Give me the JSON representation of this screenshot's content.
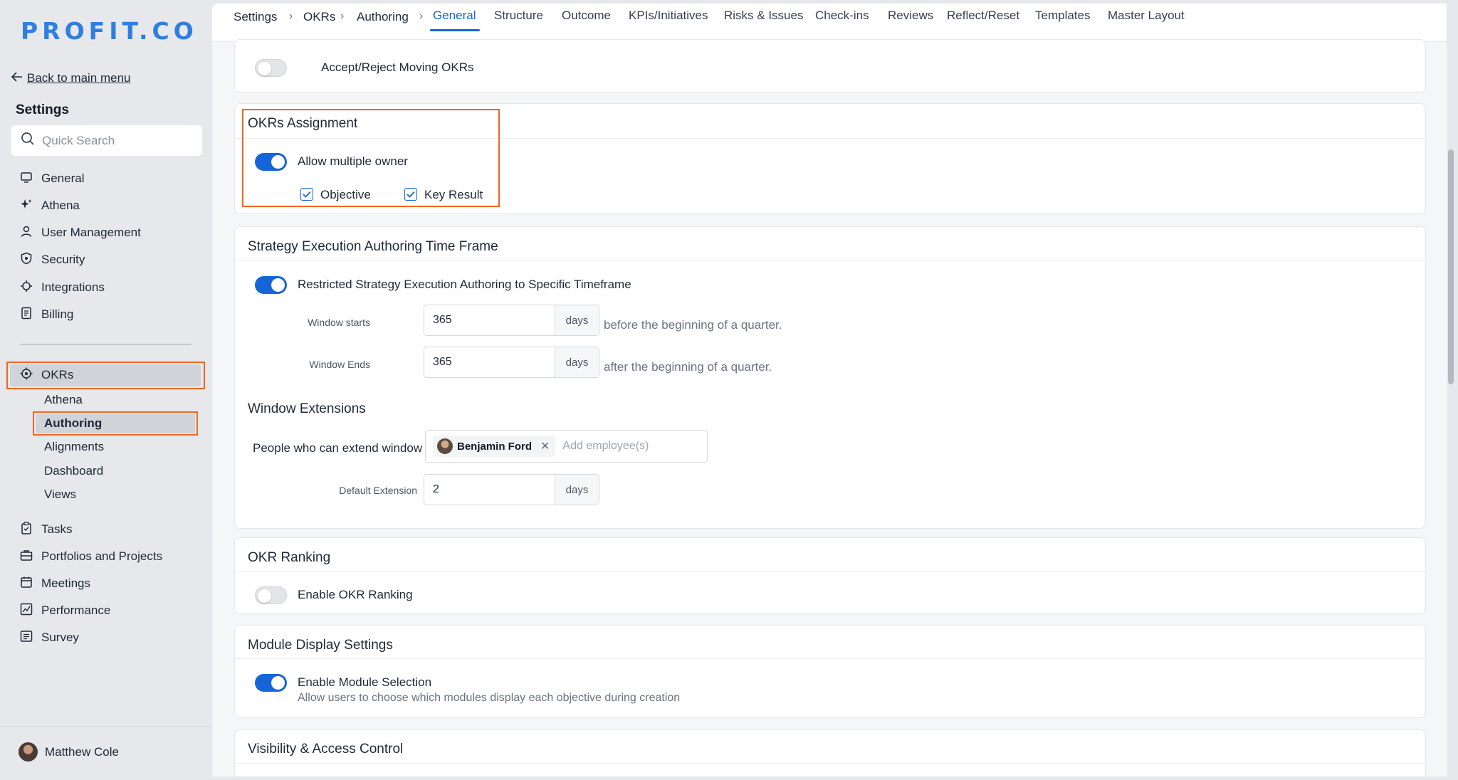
{
  "brand": {
    "logo": "PROFIT.CO"
  },
  "sidebar": {
    "back_label": "Back to main menu",
    "title": "Settings",
    "search_placeholder": "Quick Search",
    "items": [
      {
        "label": "General",
        "icon": "monitor-icon"
      },
      {
        "label": "Athena",
        "icon": "sparkle-icon"
      },
      {
        "label": "User Management",
        "icon": "user-icon"
      },
      {
        "label": "Security",
        "icon": "shield-icon"
      },
      {
        "label": "Integrations",
        "icon": "gear-icon"
      },
      {
        "label": "Billing",
        "icon": "receipt-icon"
      }
    ],
    "okrs": {
      "label": "OKRs",
      "icon": "target-icon",
      "children": [
        "Athena",
        "Authoring",
        "Alignments",
        "Dashboard",
        "Views"
      ]
    },
    "more_items": [
      {
        "label": "Tasks",
        "icon": "clipboard-icon"
      },
      {
        "label": "Portfolios and Projects",
        "icon": "briefcase-icon"
      },
      {
        "label": "Meetings",
        "icon": "calendar-icon"
      },
      {
        "label": "Performance",
        "icon": "chart-icon"
      },
      {
        "label": "Survey",
        "icon": "list-icon"
      }
    ],
    "user_name": "Matthew Cole"
  },
  "breadcrumb": [
    "Settings",
    "OKRs",
    "Authoring"
  ],
  "tabs": [
    "General",
    "Structure",
    "Outcome",
    "KPIs/Initiatives",
    "Risks & Issues",
    "Check-ins",
    "Reviews",
    "Reflect/Reset",
    "Templates",
    "Master Layout"
  ],
  "active_tab": "General",
  "accept_reject": {
    "label": "Accept/Reject Moving OKRs",
    "enabled": false
  },
  "okrs_assignment": {
    "title": "OKRs Assignment",
    "toggle_label": "Allow multiple owner",
    "enabled": true,
    "objective_label": "Objective",
    "key_result_label": "Key Result"
  },
  "timeframe": {
    "title": "Strategy Execution Authoring Time Frame",
    "toggle_label": "Restricted Strategy Execution Authoring to Specific Timeframe",
    "enabled": true,
    "window_starts_label": "Window starts",
    "window_starts_value": "365",
    "window_starts_unit": "days",
    "window_starts_hint": "before the beginning of a quarter.",
    "window_ends_label": "Window Ends",
    "window_ends_value": "365",
    "window_ends_unit": "days",
    "window_ends_hint": "after the beginning of a quarter.",
    "extensions_title": "Window Extensions",
    "people_label": "People who can extend window",
    "person_chip": "Benjamin Ford",
    "add_placeholder": "Add employee(s)",
    "default_ext_label": "Default Extension",
    "default_ext_value": "2",
    "default_ext_unit": "days"
  },
  "ranking": {
    "title": "OKR Ranking",
    "toggle_label": "Enable OKR Ranking",
    "enabled": false
  },
  "module_display": {
    "title": "Module Display Settings",
    "toggle_label": "Enable Module Selection",
    "enabled": true,
    "description": "Allow users to choose which modules display each objective during creation"
  },
  "visibility": {
    "title": "Visibility & Access Control"
  },
  "colors": {
    "accent": "#1565d8",
    "highlight": "#f26522",
    "brand": "#2f7fe0"
  }
}
